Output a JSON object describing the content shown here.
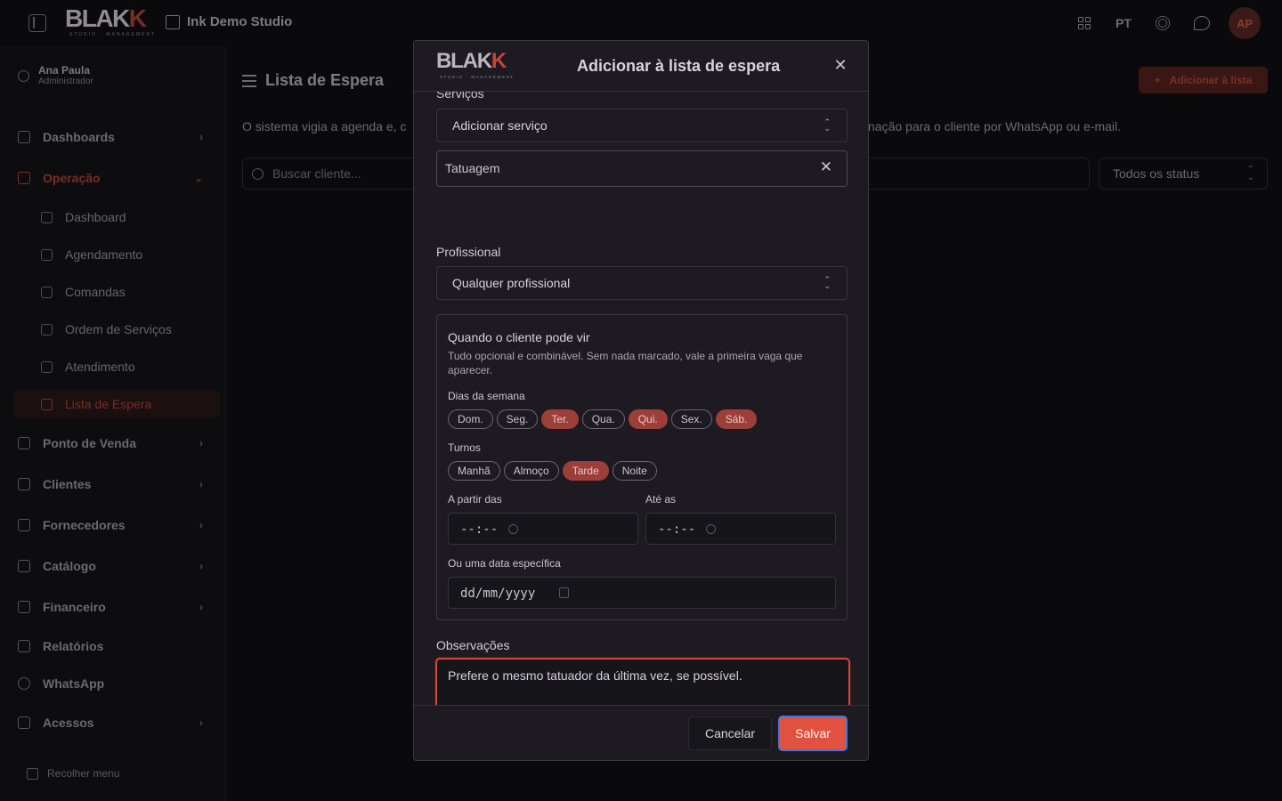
{
  "topbar": {
    "logo": "BLAK",
    "logo_k": "K",
    "logo_sub": "STUDIO · MANAGEMENT",
    "studio_name": "Ink Demo Studio",
    "lang": "PT",
    "avatar": "AP"
  },
  "sidebar": {
    "user_name": "Ana Paula",
    "user_role": "Administrador",
    "items": [
      {
        "label": "Dashboards"
      },
      {
        "label": "Operação"
      },
      {
        "label": "Ponto de Venda"
      },
      {
        "label": "Clientes"
      },
      {
        "label": "Fornecedores"
      },
      {
        "label": "Catálogo"
      },
      {
        "label": "Financeiro"
      },
      {
        "label": "Relatórios"
      },
      {
        "label": "WhatsApp"
      },
      {
        "label": "Acessos"
      }
    ],
    "sub_items": [
      {
        "label": "Dashboard"
      },
      {
        "label": "Agendamento"
      },
      {
        "label": "Comandas"
      },
      {
        "label": "Ordem de Serviços"
      },
      {
        "label": "Atendimento"
      },
      {
        "label": "Lista de Espera"
      }
    ],
    "collapse_label": "Recolher menu"
  },
  "main": {
    "title": "Lista de Espera",
    "add_button": "Adicionar à lista",
    "description_left": "O sistema vigia a agenda e, c",
    "description_right": "nação para o cliente por WhatsApp ou e-mail.",
    "search_placeholder": "Buscar cliente...",
    "status_filter": "Todos os status"
  },
  "modal": {
    "title": "Adicionar à lista de espera",
    "services_label": "Serviços",
    "service_select": "Adicionar serviço",
    "selected_service": "Tatuagem",
    "professional_label": "Profissional",
    "professional_select": "Qualquer profissional",
    "when": {
      "title": "Quando o cliente pode vir",
      "description": "Tudo opcional e combinável. Sem nada marcado, vale a primeira vaga que aparecer.",
      "days_label": "Dias da semana",
      "days": [
        {
          "label": "Dom.",
          "selected": false
        },
        {
          "label": "Seg.",
          "selected": false
        },
        {
          "label": "Ter.",
          "selected": true
        },
        {
          "label": "Qua.",
          "selected": false
        },
        {
          "label": "Qui.",
          "selected": true
        },
        {
          "label": "Sex.",
          "selected": false
        },
        {
          "label": "Sáb.",
          "selected": true
        }
      ],
      "shifts_label": "Turnos",
      "shifts": [
        {
          "label": "Manhã",
          "selected": false
        },
        {
          "label": "Almoço",
          "selected": false
        },
        {
          "label": "Tarde",
          "selected": true
        },
        {
          "label": "Noite",
          "selected": false
        }
      ],
      "from_label": "A partir das",
      "from_value": "--:--",
      "until_label": "Até as",
      "until_value": "--:--",
      "date_label": "Ou uma data específica",
      "date_value": "dd/mm/yyyy"
    },
    "notes_label": "Observações",
    "notes_value": "Prefere o mesmo tatuador da última vez, se possível.",
    "cancel_button": "Cancelar",
    "save_button": "Salvar"
  },
  "colors": {
    "accent": "#e0523f",
    "chip_selected": "#9c3f38",
    "focus_ring": "#4a73d6"
  }
}
